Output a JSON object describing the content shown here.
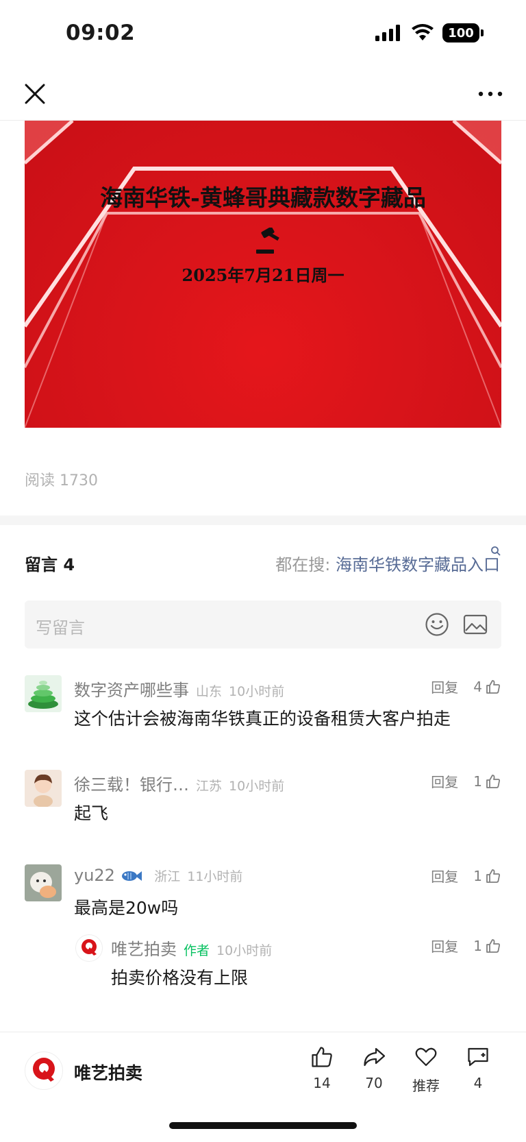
{
  "status_bar": {
    "time": "09:02",
    "battery": "100"
  },
  "banner": {
    "title": "海南华铁-黄蜂哥典藏款数字藏品",
    "date": "2025年7月21日周一"
  },
  "read_count": "阅读 1730",
  "comments": {
    "title": "留言 4",
    "search_prefix": "都在搜: ",
    "search_link": "海南华铁数字藏品入口",
    "compose_placeholder": "写留言",
    "reply_label": "回复",
    "items": [
      {
        "name": "数字资产哪些事",
        "location": "山东",
        "time": "10小时前",
        "likes": "4",
        "text": "这个估计会被海南华铁真正的设备租赁大客户拍走"
      },
      {
        "name": "徐三载！银行…",
        "location": "江苏",
        "time": "10小时前",
        "likes": "1",
        "text": "起飞"
      },
      {
        "name": "yu22",
        "location": "浙江",
        "time": "11小时前",
        "likes": "1",
        "text": "最高是20w吗"
      }
    ],
    "reply": {
      "name": "唯艺拍卖",
      "badge": "作者",
      "time": "10小时前",
      "likes": "1",
      "text": "拍卖价格没有上限"
    }
  },
  "bottom_bar": {
    "account_name": "唯艺拍卖",
    "like_count": "14",
    "share_count": "70",
    "recommend_label": "推荐",
    "comment_count": "4"
  },
  "colors": {
    "banner_red": "#d9141a",
    "link_blue": "#576b95",
    "author_green": "#07c160"
  }
}
